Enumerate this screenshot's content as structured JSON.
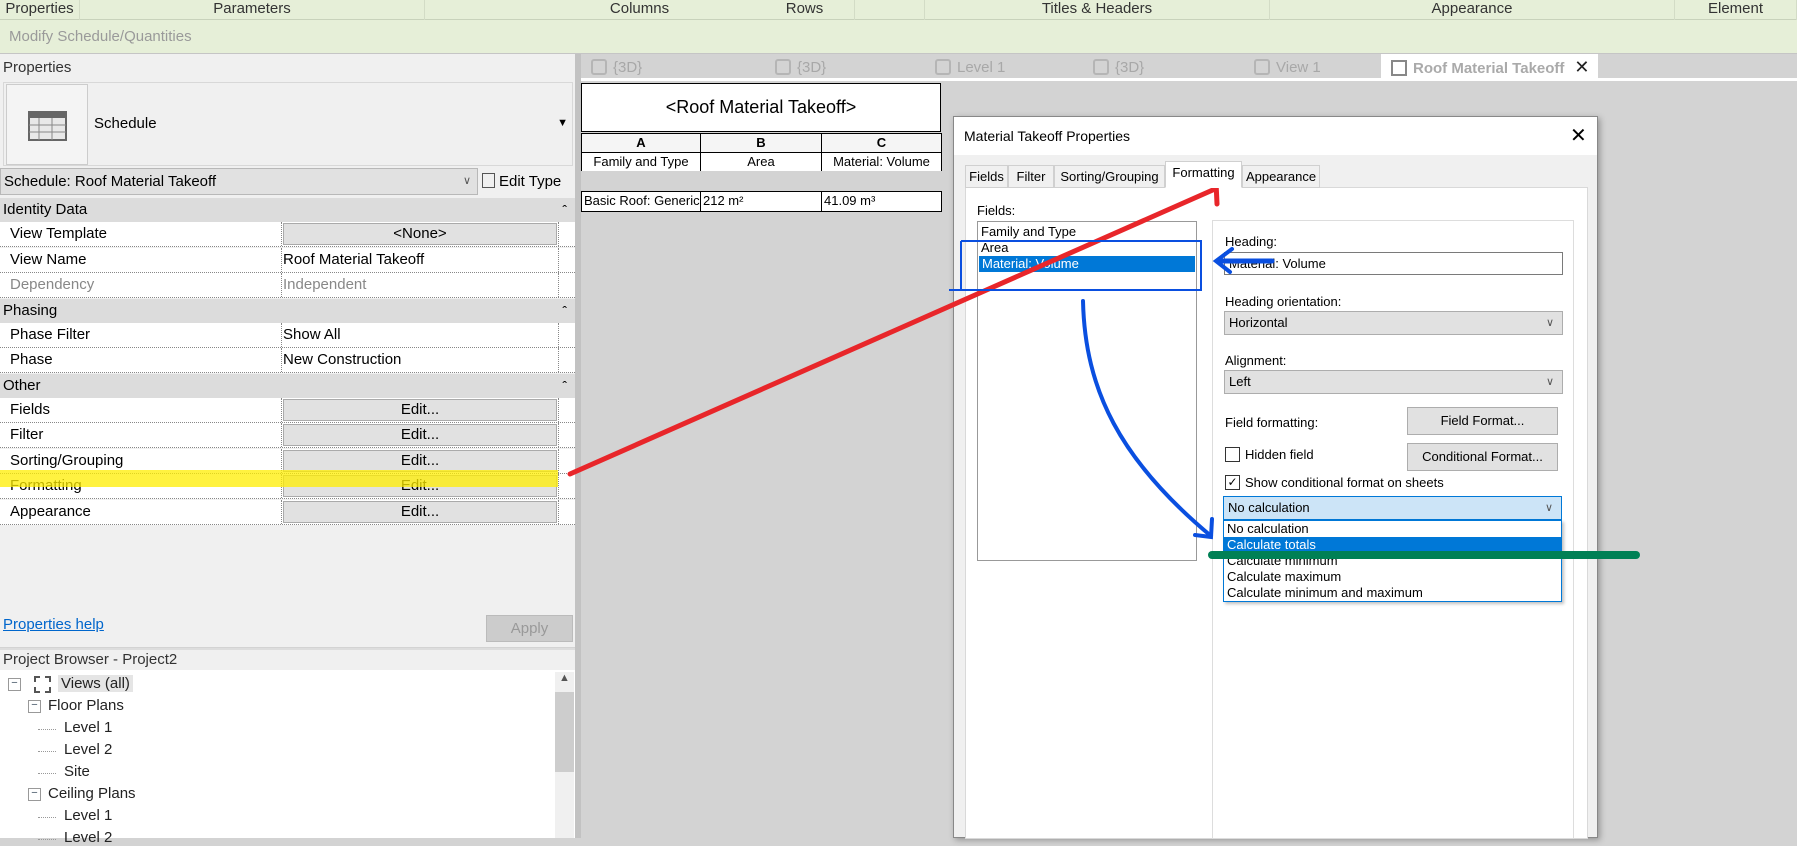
{
  "ribbon": {
    "tabs": [
      "Properties",
      "Parameters",
      "Columns",
      "Rows",
      "Titles & Headers",
      "Appearance",
      "Element"
    ],
    "context": "Modify Schedule/Quantities"
  },
  "properties": {
    "title": "Properties",
    "type_name": "Schedule",
    "type_selector": "Schedule: Roof Material Takeoff",
    "edit_type": "Edit Type",
    "groups": [
      {
        "name": "Identity Data",
        "rows": [
          {
            "k": "View Template",
            "v": "<None>",
            "button": true
          },
          {
            "k": "View Name",
            "v": "Roof Material Takeoff"
          },
          {
            "k": "Dependency",
            "v": "Independent",
            "disabled": true
          }
        ]
      },
      {
        "name": "Phasing",
        "rows": [
          {
            "k": "Phase Filter",
            "v": "Show All"
          },
          {
            "k": "Phase",
            "v": "New Construction"
          }
        ]
      },
      {
        "name": "Other",
        "rows": [
          {
            "k": "Fields",
            "v": "Edit...",
            "button": true
          },
          {
            "k": "Filter",
            "v": "Edit...",
            "button": true
          },
          {
            "k": "Sorting/Grouping",
            "v": "Edit...",
            "button": true
          },
          {
            "k": "Formatting",
            "v": "Edit...",
            "button": true
          },
          {
            "k": "Appearance",
            "v": "Edit...",
            "button": true
          }
        ]
      }
    ],
    "help_link": "Properties help",
    "apply": "Apply"
  },
  "browser": {
    "title": "Project Browser - Project2",
    "items": [
      {
        "label": "Views (all)",
        "level": 0,
        "expand": true
      },
      {
        "label": "Floor Plans",
        "level": 1,
        "expand": true
      },
      {
        "label": "Level 1",
        "level": 2
      },
      {
        "label": "Level 2",
        "level": 2
      },
      {
        "label": "Site",
        "level": 2
      },
      {
        "label": "Ceiling Plans",
        "level": 1,
        "expand": true
      },
      {
        "label": "Level 1",
        "level": 2
      },
      {
        "label": "Level 2",
        "level": 2
      }
    ]
  },
  "view_tabs": [
    {
      "label": "{3D}",
      "icon": "house-3d-icon"
    },
    {
      "label": "{3D}",
      "icon": "house-3d-icon"
    },
    {
      "label": "Level 1",
      "icon": "floor-plan-icon"
    },
    {
      "label": "{3D}",
      "icon": "house-3d-icon"
    },
    {
      "label": "View 1",
      "icon": "house-3d-icon"
    },
    {
      "label": "Roof Material Takeoff",
      "icon": "schedule-icon",
      "active": true
    }
  ],
  "schedule": {
    "title": "<Roof Material Takeoff>",
    "letters": [
      "A",
      "B",
      "C"
    ],
    "headers": [
      "Family and Type",
      "Area",
      "Material: Volume"
    ],
    "rows": [
      [
        "Basic Roof: Generic",
        "212 m²",
        "41.09 m³"
      ]
    ]
  },
  "dialog": {
    "title": "Material Takeoff Properties",
    "tabs": [
      "Fields",
      "Filter",
      "Sorting/Grouping",
      "Formatting",
      "Appearance"
    ],
    "active_tab": "Formatting",
    "fields_label": "Fields:",
    "fields": [
      "Family and Type",
      "Area",
      "Material: Volume"
    ],
    "selected_field": "Material: Volume",
    "heading_label": "Heading:",
    "heading_value": "Material: Volume",
    "orientation_label": "Heading orientation:",
    "orientation_value": "Horizontal",
    "alignment_label": "Alignment:",
    "alignment_value": "Left",
    "field_formatting_label": "Field formatting:",
    "field_format_btn": "Field Format...",
    "hidden_field_label": "Hidden field",
    "hidden_field": false,
    "conditional_btn": "Conditional  Format...",
    "show_conditional_label": "Show conditional format on sheets",
    "show_conditional": true,
    "calc_value": "No calculation",
    "calc_options": [
      "No calculation",
      "Calculate totals",
      "Calculate minimum",
      "Calculate maximum",
      "Calculate minimum and maximum"
    ],
    "calc_highlight": "Calculate totals"
  },
  "colors": {
    "selection": "#0078d7",
    "annotation_red": "#e8262a",
    "annotation_blue": "#0a4fe0",
    "annotation_green": "#008055",
    "highlight_yellow": "#ffee00"
  }
}
